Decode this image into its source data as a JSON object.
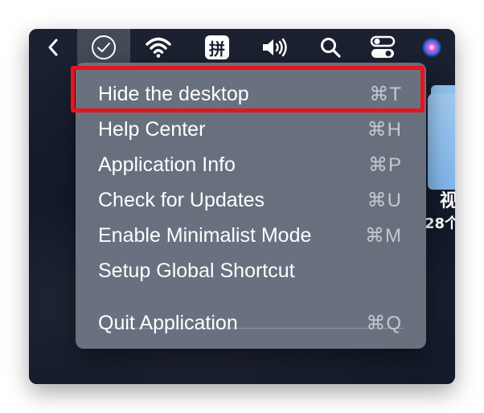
{
  "menubar": {
    "items": [
      {
        "name": "back-chevron-icon"
      },
      {
        "name": "checkmark-circle-icon"
      },
      {
        "name": "wifi-icon"
      },
      {
        "name": "input-method-icon",
        "label": "拼"
      },
      {
        "name": "volume-icon"
      },
      {
        "name": "search-icon"
      },
      {
        "name": "control-center-icon"
      },
      {
        "name": "siri-icon"
      }
    ]
  },
  "desktop": {
    "label_line1": "视",
    "label_line2": "28个"
  },
  "menu": {
    "items": [
      {
        "label": "Hide the desktop",
        "shortcut": "⌘T"
      },
      {
        "label": "Help Center",
        "shortcut": "⌘H"
      },
      {
        "label": "Application Info",
        "shortcut": "⌘P"
      },
      {
        "label": "Check for Updates",
        "shortcut": "⌘U"
      },
      {
        "label": "Enable Minimalist Mode",
        "shortcut": "⌘M"
      },
      {
        "label": "Setup Global Shortcut",
        "shortcut": ""
      },
      {
        "label": "Quit Application",
        "shortcut": "⌘Q"
      }
    ]
  },
  "colors": {
    "highlight": "#e8141c",
    "menu_bg": "#6c7482",
    "menubar_bg": "#1b2130"
  }
}
